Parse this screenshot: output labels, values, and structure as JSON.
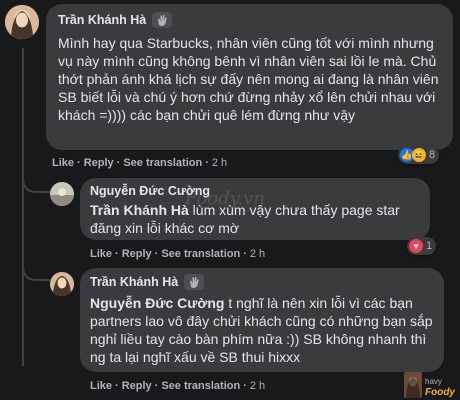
{
  "colors": {
    "background": "#18191a",
    "bubble": "#3a3b3c",
    "muted": "#b0b3b8",
    "text": "#e4e6eb",
    "like_blue": "#1877f2",
    "love_red": "#f33e58",
    "haha_yellow": "#f7b125"
  },
  "comments": [
    {
      "author": "Trần Khánh Hà",
      "text": "Mình hay qua Starbucks, nhân viên cũng tốt với mình nhưng vụ này mình cũng không bênh vì nhân viên sai lồi le mà. Chủ thớt phản ánh khá lịch sự đấy nên mong ai đang là nhân viên SB biết lỗi và chú ý hơn chứ đừng nhảy xổ lên chửi nhau với khách =)))) các bạn chửi quê lém đừng như vậy",
      "actions": {
        "like": "Like",
        "reply": "Reply",
        "translate": "See translation",
        "time": "2 h",
        "sep": "·"
      },
      "reactions": {
        "count": "8",
        "icons": [
          "like-icon",
          "haha-icon"
        ]
      }
    },
    {
      "author": "Nguyễn Đức Cường",
      "mention": "Trần Khánh Hà",
      "text": " lùm xùm vậy chưa thấy page star đăng xin lỗi khác cơ mờ",
      "actions": {
        "like": "Like",
        "reply": "Reply",
        "translate": "See translation",
        "time": "2 h",
        "sep": "·"
      },
      "reactions": {
        "count": "1",
        "icons": [
          "love-icon"
        ]
      }
    },
    {
      "author": "Trần Khánh Hà",
      "mention": "Nguyễn Đức Cường",
      "text": " t nghĩ là nên xin lỗi vì các bạn partners lao vô đây chửi khách cũng có những bạn sắp nghỉ liều tay cào bàn phím nữa :)) SB không nhanh thì ng ta lại nghĩ xấu về SB thui hixxx",
      "actions": {
        "like": "Like",
        "reply": "Reply",
        "translate": "See translation",
        "time": "2 h",
        "sep": "·"
      }
    }
  ],
  "watermark": {
    "center": "Foody.vn",
    "corner_name": "havy",
    "corner_brand": "Foody"
  }
}
